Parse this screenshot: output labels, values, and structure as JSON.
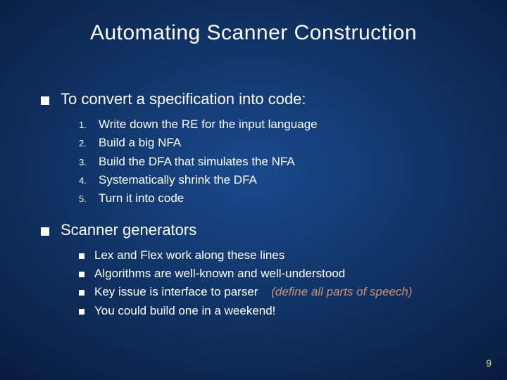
{
  "title": "Automating Scanner Construction",
  "section1": {
    "heading": "To convert a specification into code:",
    "items": [
      "Write down the RE for the input language",
      "Build a big NFA",
      "Build the DFA that simulates the NFA",
      "Systematically shrink the DFA",
      "Turn it into code"
    ]
  },
  "section2": {
    "heading": "Scanner generators",
    "items": [
      {
        "text": "Lex and Flex work along these lines"
      },
      {
        "text": "Algorithms are well-known and well-understood"
      },
      {
        "text": "Key issue is interface to parser",
        "paren": "(define all parts of speech)"
      },
      {
        "text": "You could build one in a weekend!"
      }
    ]
  },
  "page_number": "9"
}
